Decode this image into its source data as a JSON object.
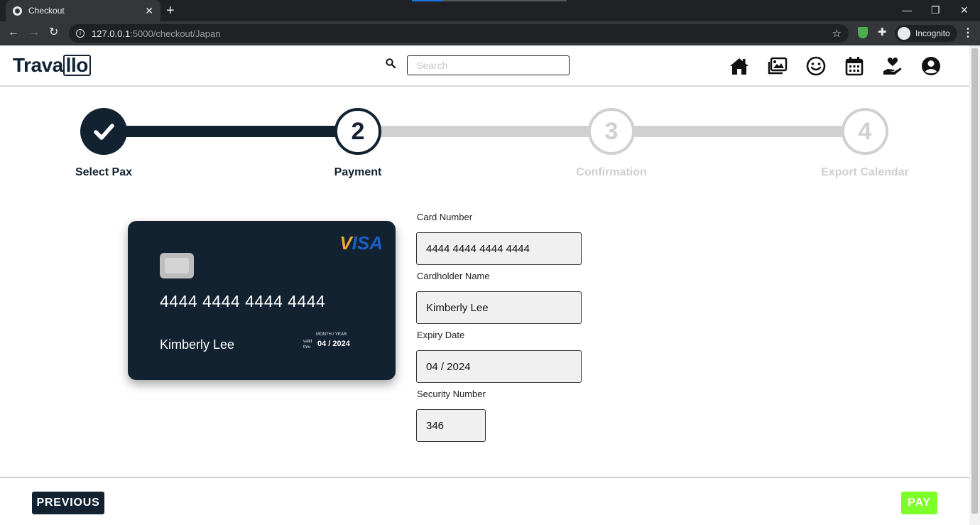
{
  "browser": {
    "tab_title": "Checkout",
    "tab_close": "✕",
    "new_tab": "+",
    "url_host": "127.0.0.1",
    "url_path": ":5000/checkout/Japan",
    "profile_label": "Incognito"
  },
  "navbar": {
    "logo_text": "Trava",
    "logo_box_text": "llo",
    "search_placeholder": "Search",
    "icons": [
      "home-icon",
      "gallery-icon",
      "smiley-icon",
      "calendar-icon",
      "donate-icon",
      "account-icon"
    ]
  },
  "stepper": {
    "steps": [
      {
        "number": "✓",
        "label": "Select Pax",
        "state": "complete"
      },
      {
        "number": "2",
        "label": "Payment",
        "state": "current"
      },
      {
        "number": "3",
        "label": "Confirmation",
        "state": "pending"
      },
      {
        "number": "4",
        "label": "Export Calendar",
        "state": "pending"
      }
    ]
  },
  "card": {
    "brand": "VISA",
    "number": "4444 4444 4444 4444",
    "holder": "Kimberly Lee",
    "valid_thru_line1": "valid",
    "valid_thru_line2": "thru",
    "month_year_label": "MONTH / YEAR",
    "expiry": "04 / 2024",
    "background_color": "#122231"
  },
  "form": {
    "card_number_label": "Card Number",
    "card_number_value": "4444 4444 4444 4444",
    "cardholder_label": "Cardholder Name",
    "cardholder_value": "Kimberly Lee",
    "expiry_label": "Expiry Date",
    "expiry_value": "04 / 2024",
    "security_label": "Security Number",
    "security_value": "346"
  },
  "footer": {
    "previous_label": "PREVIOUS",
    "pay_label": "PAY",
    "pay_color": "#7dff2a"
  }
}
